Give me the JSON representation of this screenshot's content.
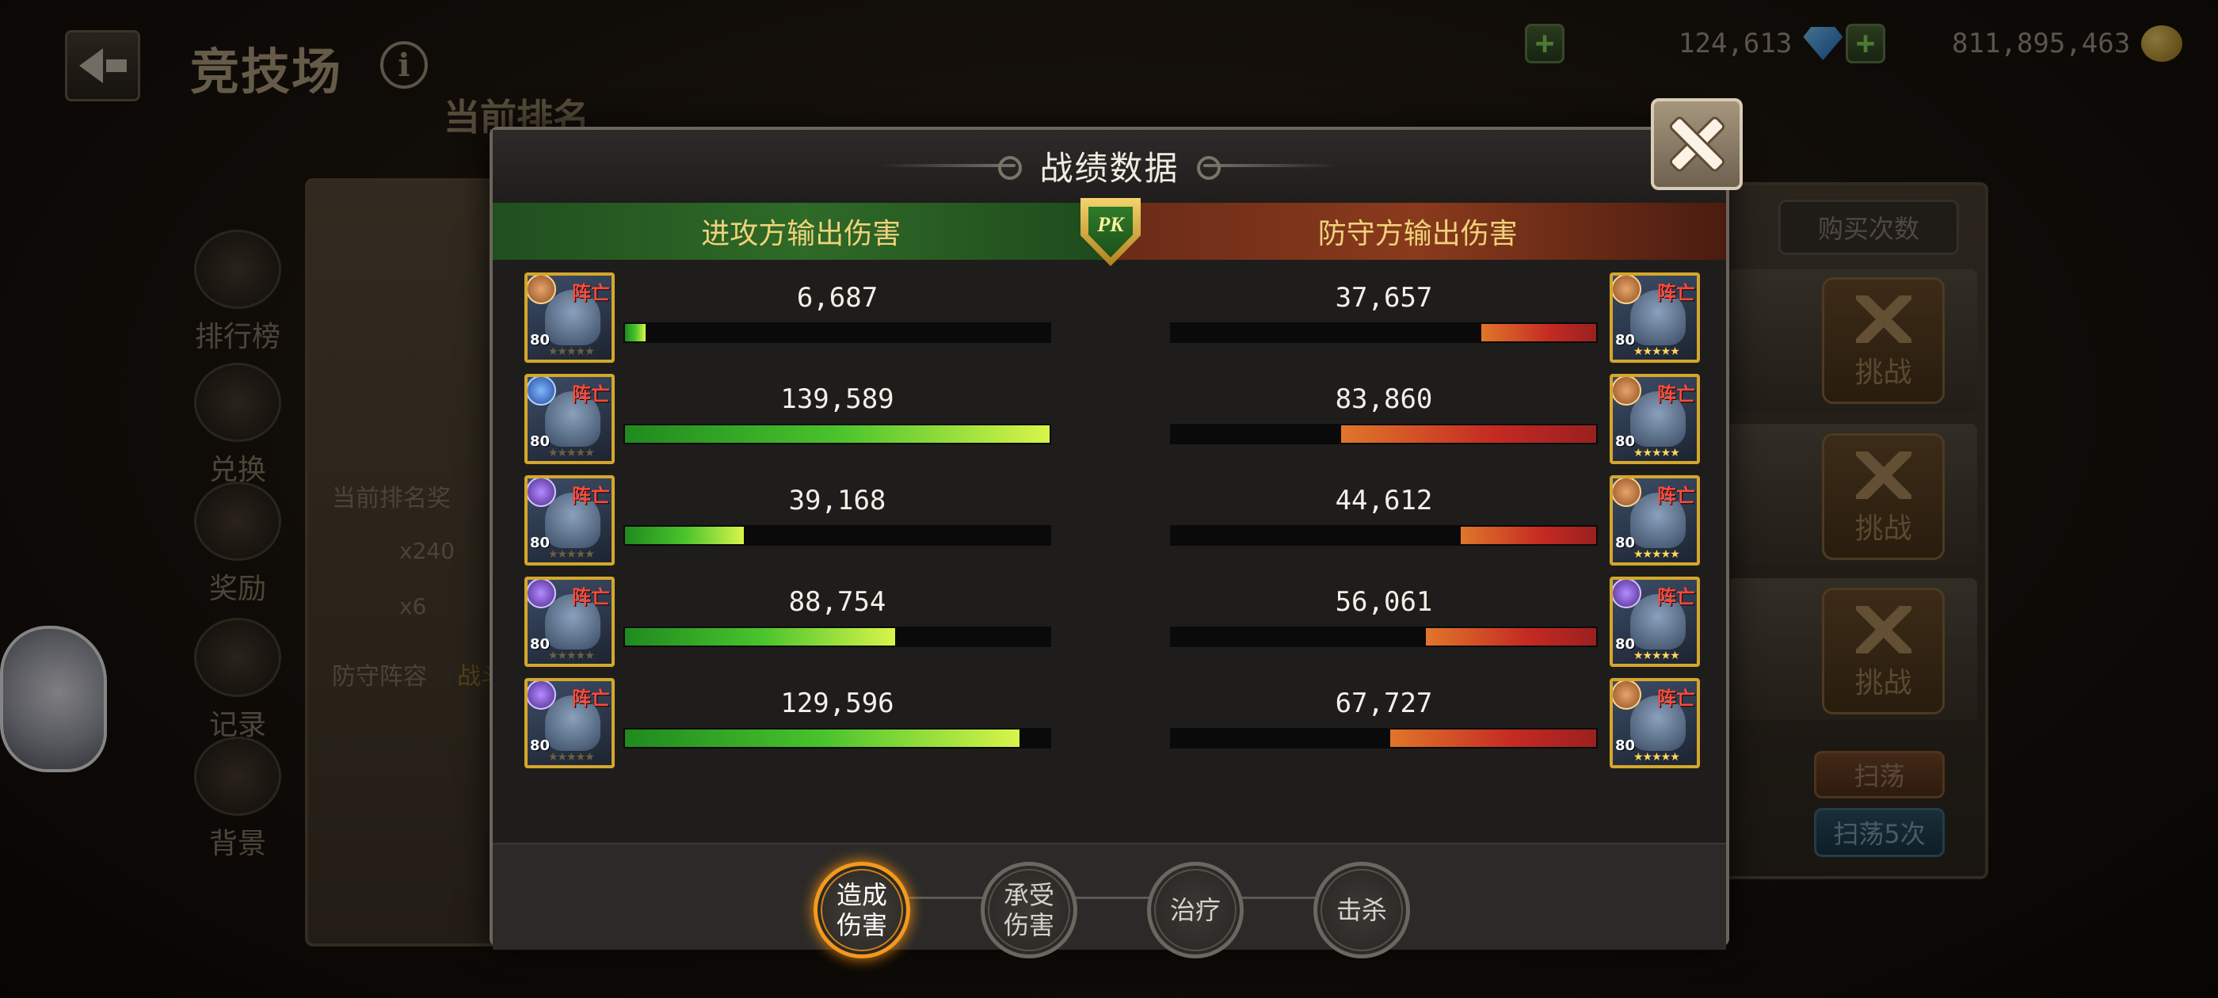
{
  "header": {
    "title": "竞技场",
    "rank_title": "当前排名"
  },
  "currencies": {
    "gems": "124,613",
    "gold": "811,895,463"
  },
  "side_menu": [
    {
      "label": "排行榜",
      "icon": "leaderboard-icon"
    },
    {
      "label": "兑换",
      "icon": "exchange-icon"
    },
    {
      "label": "奖励",
      "icon": "reward-chest-icon"
    },
    {
      "label": "记录",
      "icon": "record-book-icon"
    },
    {
      "label": "背景",
      "icon": "background-castle-icon"
    }
  ],
  "left_panel": {
    "reward_label": "当前排名奖",
    "gem_reward": "x240",
    "item_reward": "x6",
    "defense_label": "防守阵容",
    "defense_label_extra": "战斗"
  },
  "right_panel": {
    "buy_label": "购买次数",
    "challenge_label": "挑战",
    "sweep_label": "扫荡",
    "sweep5_label": "扫荡5次"
  },
  "modal": {
    "title": "战绩数据",
    "attacker_header": "进攻方输出伤害",
    "defender_header": "防守方输出伤害",
    "pk_badge": "PK",
    "dead_label": "阵亡",
    "max_value": 139589,
    "attackers": [
      {
        "level": "80",
        "value": "6,687",
        "num": 6687,
        "class": "orange"
      },
      {
        "level": "80",
        "value": "139,589",
        "num": 139589,
        "class": "blue"
      },
      {
        "level": "80",
        "value": "39,168",
        "num": 39168,
        "class": "purple"
      },
      {
        "level": "80",
        "value": "88,754",
        "num": 88754,
        "class": "purple"
      },
      {
        "level": "80",
        "value": "129,596",
        "num": 129596,
        "class": "purple"
      }
    ],
    "defenders": [
      {
        "level": "80",
        "value": "37,657",
        "num": 37657,
        "class": "orange"
      },
      {
        "level": "80",
        "value": "83,860",
        "num": 83860,
        "class": "orange"
      },
      {
        "level": "80",
        "value": "44,612",
        "num": 44612,
        "class": "orange"
      },
      {
        "level": "80",
        "value": "56,061",
        "num": 56061,
        "class": "purple"
      },
      {
        "level": "80",
        "value": "67,727",
        "num": 67727,
        "class": "orange"
      }
    ],
    "tabs": [
      {
        "label": "造成\n伤害",
        "active": true
      },
      {
        "label": "承受\n伤害",
        "active": false
      },
      {
        "label": "治疗",
        "active": false
      },
      {
        "label": "击杀",
        "active": false
      }
    ]
  }
}
